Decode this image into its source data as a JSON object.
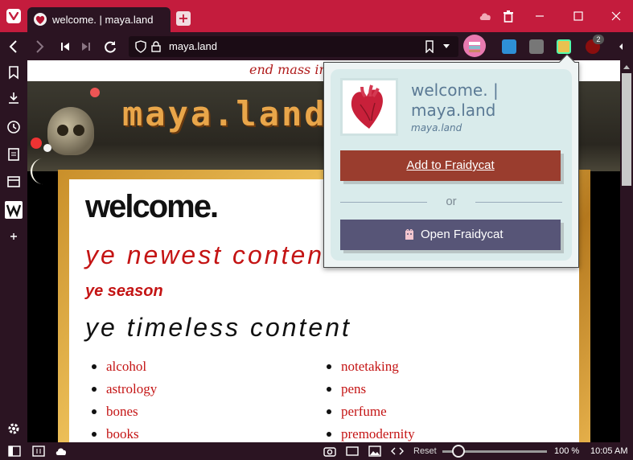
{
  "browser": {
    "tab_title": "welcome. | maya.land",
    "url": "maya.land",
    "extension_badge": "2"
  },
  "page": {
    "marquee": "end mass incarceration",
    "banner_title": "maya.land",
    "heading_welcome": "welcome.",
    "heading_newest": "ye newest content",
    "heading_season": "ye season",
    "heading_timeless": "ye timeless content",
    "topics_left": [
      "alcohol",
      "astrology",
      "bones",
      "books"
    ],
    "topics_right": [
      "notetaking",
      "pens",
      "perfume",
      "premodernity"
    ]
  },
  "popup": {
    "title": "welcome. | maya.land",
    "domain": "maya.land",
    "add_label": "Add to Fraidycat",
    "or_label": "or",
    "open_label": "Open Fraidycat"
  },
  "statusbar": {
    "reset_label": "Reset",
    "zoom": "100 %",
    "zoom_fraction": 0.15,
    "time": "10:05 AM"
  },
  "colors": {
    "accent": "#c41c3d",
    "chrome": "#2b1422",
    "add_button": "#9a3d2e",
    "open_button": "#575577",
    "link": "#c41414"
  }
}
